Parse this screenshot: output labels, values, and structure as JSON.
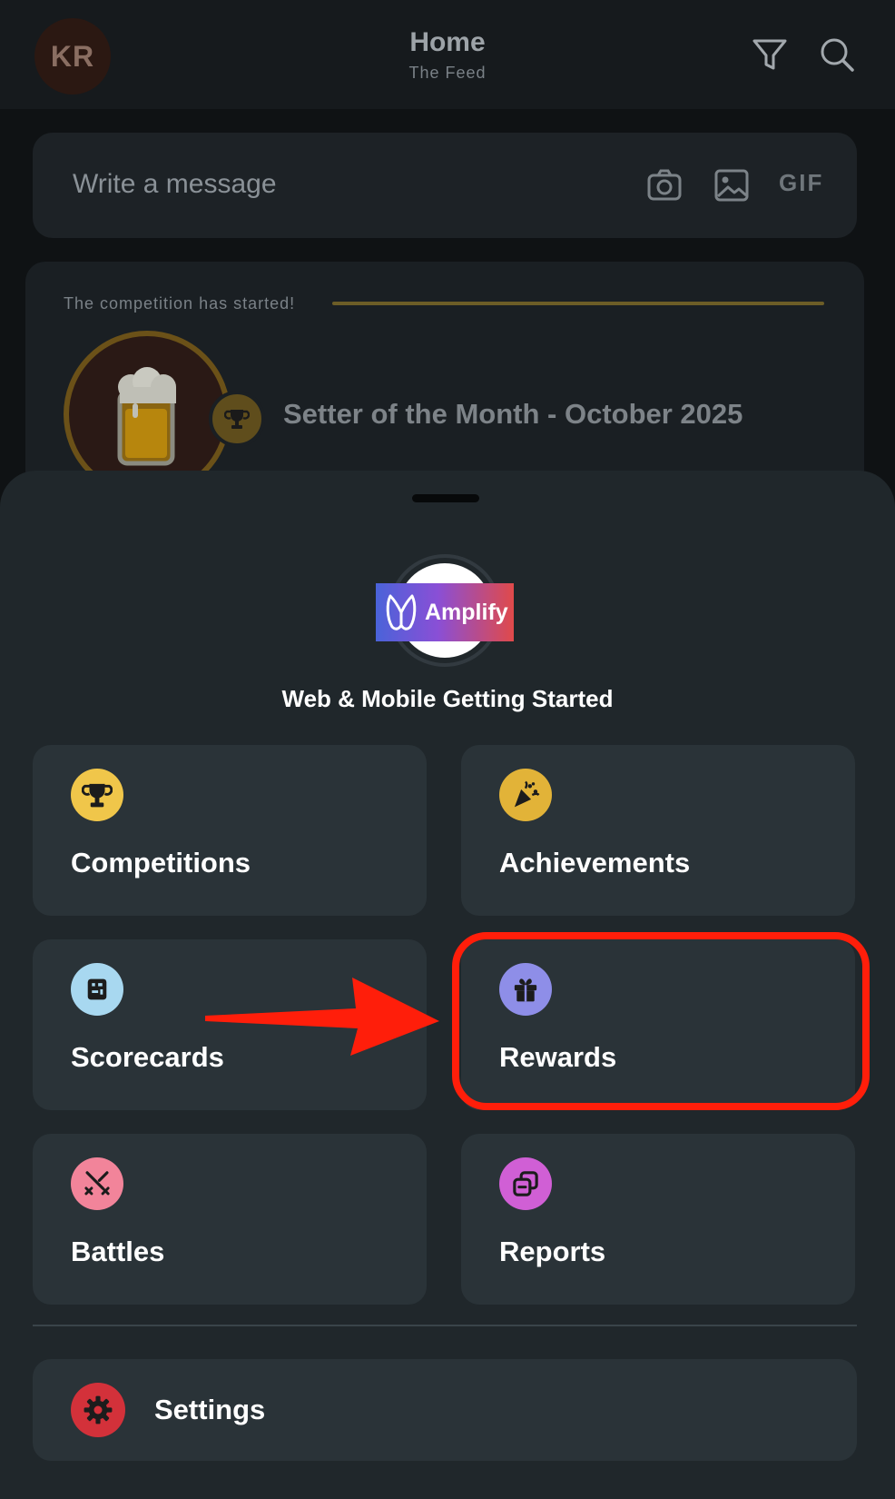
{
  "header": {
    "avatar_initials": "KR",
    "title": "Home",
    "subtitle": "The Feed",
    "icons": [
      "filter-icon",
      "search-icon"
    ]
  },
  "composer": {
    "placeholder": "Write a message",
    "icons": [
      "camera-icon",
      "image-icon"
    ],
    "gif_label": "GIF"
  },
  "competition_card": {
    "status": "The competition has started!",
    "title": "Setter of the Month - October 2025",
    "icons": [
      "beer-mug-icon",
      "trophy-icon"
    ]
  },
  "sheet": {
    "brand_name": "Amplify",
    "title": "Web & Mobile Getting Started",
    "tiles": [
      {
        "label": "Competitions",
        "icon": "trophy-icon",
        "color": "#f0c64a"
      },
      {
        "label": "Achievements",
        "icon": "party-popper-icon",
        "color": "#e2b338"
      },
      {
        "label": "Scorecards",
        "icon": "scorecard-icon",
        "color": "#a8d8f0"
      },
      {
        "label": "Rewards",
        "icon": "gift-icon",
        "color": "#8e8ee8"
      },
      {
        "label": "Battles",
        "icon": "crossed-swords-icon",
        "color": "#f2849a"
      },
      {
        "label": "Reports",
        "icon": "reports-icon",
        "color": "#d05fd5"
      }
    ],
    "settings_label": "Settings",
    "settings_icon_color": "#d3313a"
  },
  "annotation": {
    "highlighted_item": "Rewards",
    "color": "#ff1e0a"
  }
}
